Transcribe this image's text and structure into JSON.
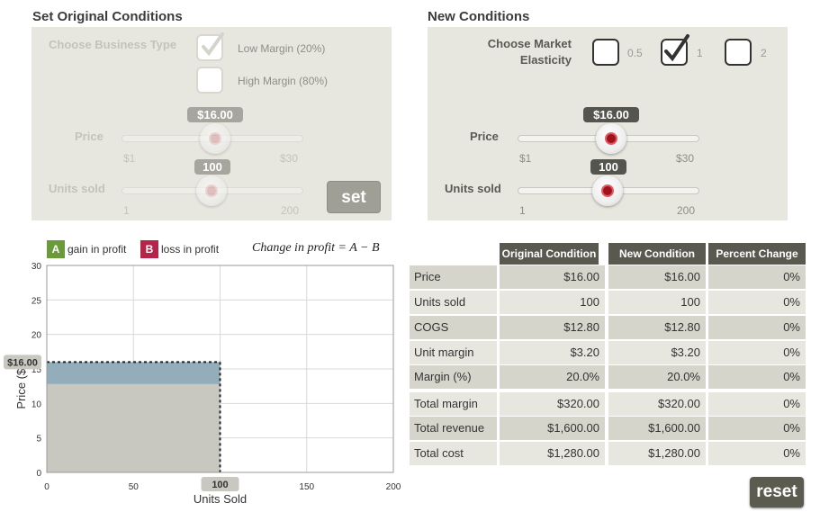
{
  "original": {
    "title": "Set Original Conditions",
    "business_type_label": "Choose Business Type",
    "options": [
      "Low Margin (20%)",
      "High Margin (80%)"
    ],
    "price_label": "Price",
    "price_value": "$16.00",
    "price_min": "$1",
    "price_max": "$30",
    "units_label": "Units sold",
    "units_value": "100",
    "units_min": "1",
    "units_max": "200",
    "set_label": "set"
  },
  "new": {
    "title": "New Conditions",
    "elasticity_label_1": "Choose Market",
    "elasticity_label_2": "Elasticity",
    "elasticity_options": [
      "0.5",
      "1",
      "2"
    ],
    "elasticity_selected": "1",
    "price_label": "Price",
    "price_value": "$16.00",
    "price_min": "$1",
    "price_max": "$30",
    "units_label": "Units sold",
    "units_value": "100",
    "units_min": "1",
    "units_max": "200"
  },
  "legend": {
    "a_letter": "A",
    "a_label": "gain in profit",
    "b_letter": "B",
    "b_label": "loss in profit",
    "formula": "Change in profit = A − B"
  },
  "chart_data": {
    "type": "area",
    "xlabel": "Units Sold",
    "ylabel": "Price ($)",
    "xlim": [
      0,
      200
    ],
    "ylim": [
      0,
      30
    ],
    "x_ticks": [
      "0",
      "50",
      "100",
      "150",
      "200"
    ],
    "y_ticks": [
      "0",
      "5",
      "10",
      "15",
      "20",
      "25",
      "30"
    ],
    "units": 100,
    "price": 16,
    "cogs_per_unit": 12.8,
    "price_marker": "$16.00",
    "units_marker": "100"
  },
  "table": {
    "headers": [
      "Original Condition",
      "New Condition",
      "Percent Change"
    ],
    "rows": [
      {
        "label": "Price",
        "orig": "$16.00",
        "new": "$16.00",
        "pct": "0%"
      },
      {
        "label": "Units sold",
        "orig": "100",
        "new": "100",
        "pct": "0%"
      },
      {
        "label": "COGS",
        "orig": "$12.80",
        "new": "$12.80",
        "pct": "0%"
      },
      {
        "label": "Unit margin",
        "orig": "$3.20",
        "new": "$3.20",
        "pct": "0%"
      },
      {
        "label": "Margin (%)",
        "orig": "20.0%",
        "new": "20.0%",
        "pct": "0%"
      },
      {
        "label": "Total margin",
        "orig": "$320.00",
        "new": "$320.00",
        "pct": "0%"
      },
      {
        "label": "Total revenue",
        "orig": "$1,600.00",
        "new": "$1,600.00",
        "pct": "0%"
      },
      {
        "label": "Total cost",
        "orig": "$1,280.00",
        "new": "$1,280.00",
        "pct": "0%"
      }
    ]
  },
  "reset_label": "reset",
  "colors": {
    "panel": "#e8e7df",
    "header": "#5a5950",
    "gain": "#6a9a3a",
    "loss": "#b5254a",
    "margin_band": "#93adbb",
    "cost_area": "#c8c7c0"
  }
}
